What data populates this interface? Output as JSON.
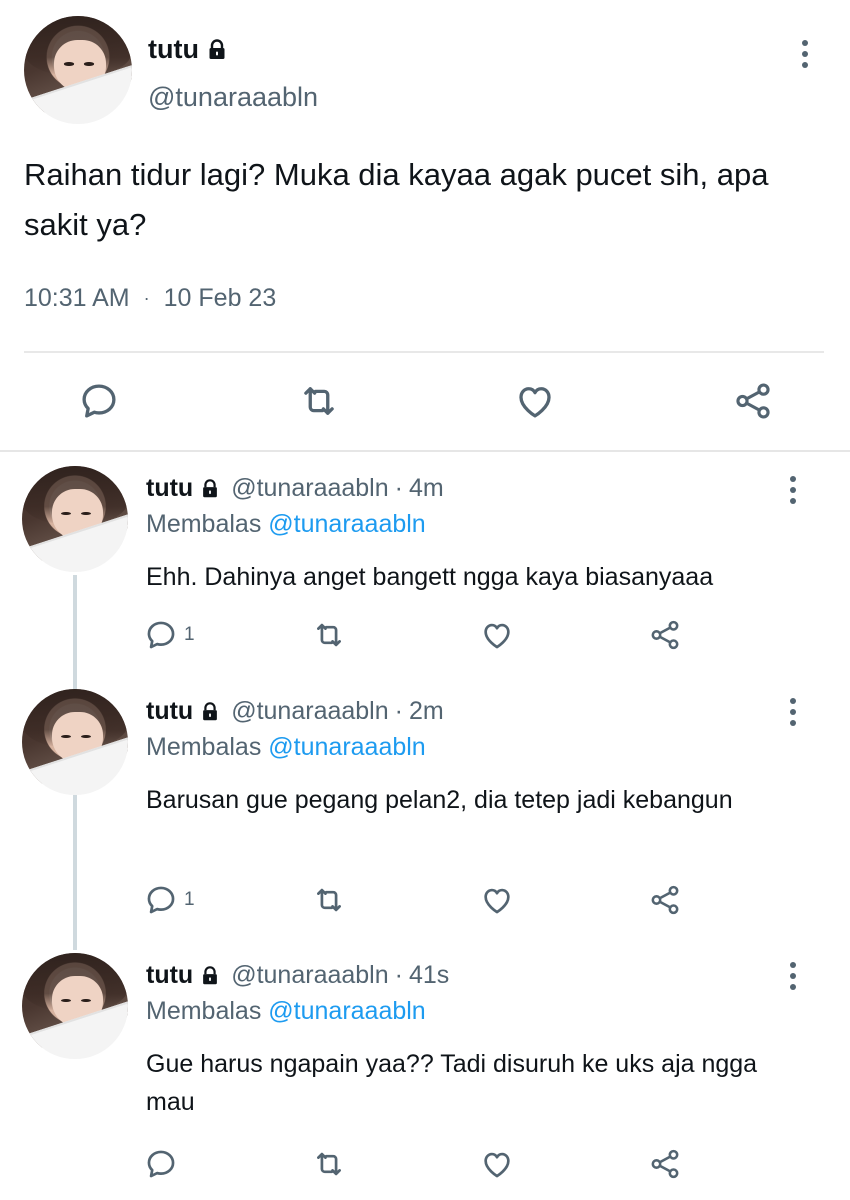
{
  "main_tweet": {
    "name": "tutu",
    "handle": "@tunaraaabln",
    "text": "Raihan tidur lagi? Muka dia kayaa agak pucet sih, apa sakit ya?",
    "time": "10:31 AM",
    "dot": "·",
    "date": "10 Feb 23"
  },
  "replies": [
    {
      "name": "tutu",
      "handle": "@tunaraaabln",
      "sep": "·",
      "time": "4m",
      "reply_prefix": "Membalas",
      "reply_to": "@tunaraaabln",
      "text": "Ehh. Dahinya anget bangett ngga kaya biasanyaaa",
      "reply_count": "1"
    },
    {
      "name": "tutu",
      "handle": "@tunaraaabln",
      "sep": "·",
      "time": "2m",
      "reply_prefix": "Membalas",
      "reply_to": "@tunaraaabln",
      "text": "Barusan gue pegang pelan2, dia tetep jadi kebangun",
      "reply_count": "1"
    },
    {
      "name": "tutu",
      "handle": "@tunaraaabln",
      "sep": "·",
      "time": "41s",
      "reply_prefix": "Membalas",
      "reply_to": "@tunaraaabln",
      "text": "Gue harus ngapain yaa?? Tadi disuruh ke uks aja ngga mau",
      "reply_count": ""
    }
  ],
  "icons": [
    "lock-icon",
    "more-icon",
    "reply-icon",
    "retweet-icon",
    "like-icon",
    "share-icon"
  ],
  "colors": {
    "link": "#1d9bf0",
    "muted": "#536471",
    "text": "#0f1419",
    "thread_line": "#cfd9de"
  }
}
